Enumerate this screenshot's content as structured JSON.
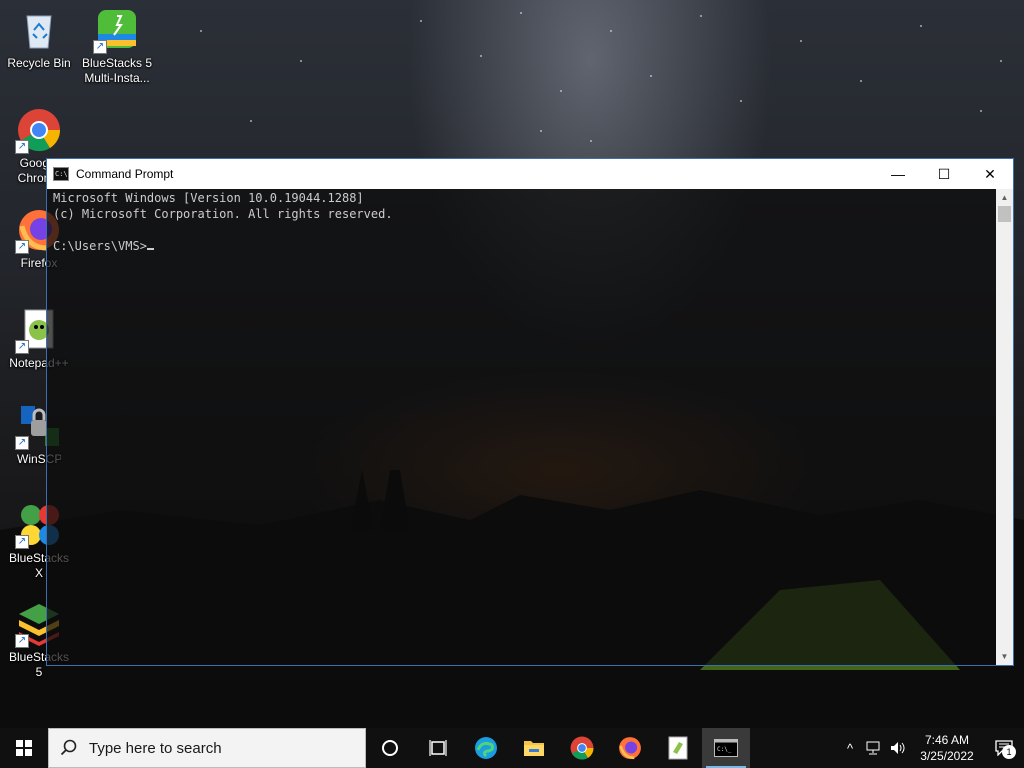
{
  "desktop": {
    "icons": [
      {
        "label": "Recycle Bin",
        "icon": "recycle-bin-icon"
      },
      {
        "label": "BlueStacks 5 Multi-Insta...",
        "icon": "bluestacks-multi-instance-icon"
      },
      {
        "label": "Google Chrome",
        "icon": "chrome-icon"
      },
      {
        "label": "Firefox",
        "icon": "firefox-icon"
      },
      {
        "label": "Notepad++",
        "icon": "notepadpp-icon"
      },
      {
        "label": "WinSCP",
        "icon": "winscp-icon"
      },
      {
        "label": "BlueStacks X",
        "icon": "bluestacks-x-icon"
      },
      {
        "label": "BlueStacks 5",
        "icon": "bluestacks-icon"
      }
    ]
  },
  "cmd": {
    "title": "Command Prompt",
    "line1": "Microsoft Windows [Version 10.0.19044.1288]",
    "line2": "(c) Microsoft Corporation. All rights reserved.",
    "line3": "",
    "prompt": "C:\\Users\\VMS>",
    "controls": {
      "minimize": "—",
      "maximize": "☐",
      "close": "✕"
    }
  },
  "taskbar": {
    "search_placeholder": "Type here to search",
    "pinned": [
      "cortana-icon",
      "task-view-icon",
      "edge-icon",
      "file-explorer-icon",
      "chrome-icon",
      "firefox-icon",
      "notepadpp-icon",
      "command-prompt-icon"
    ],
    "active": "command-prompt-icon",
    "time": "7:46 AM",
    "date": "3/25/2022",
    "notification_count": "1"
  },
  "colors": {
    "accent": "#76b9ed",
    "cmd_text": "#cccccc",
    "taskbar_bg": "#101010"
  }
}
